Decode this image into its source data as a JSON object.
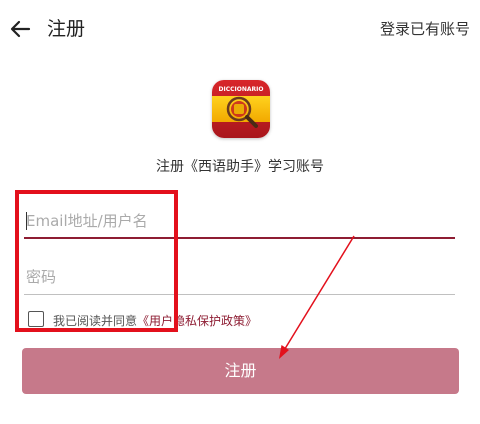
{
  "header": {
    "title": "注册",
    "login_link": "登录已有账号"
  },
  "app": {
    "subtitle": "注册《西语助手》学习账号",
    "icon_text": "DICCIONARIO"
  },
  "form": {
    "email_placeholder": "Email地址/用户名",
    "email_value": "",
    "password_placeholder": "密码",
    "password_value": "",
    "agree_text": "我已阅读并同意",
    "policy_link": "《用户隐私保护政策》",
    "agree_checked": false,
    "submit_label": "注册"
  },
  "colors": {
    "accent": "#8e1d33",
    "submit_button": "#c6798a",
    "annotation": "#e3101c"
  }
}
